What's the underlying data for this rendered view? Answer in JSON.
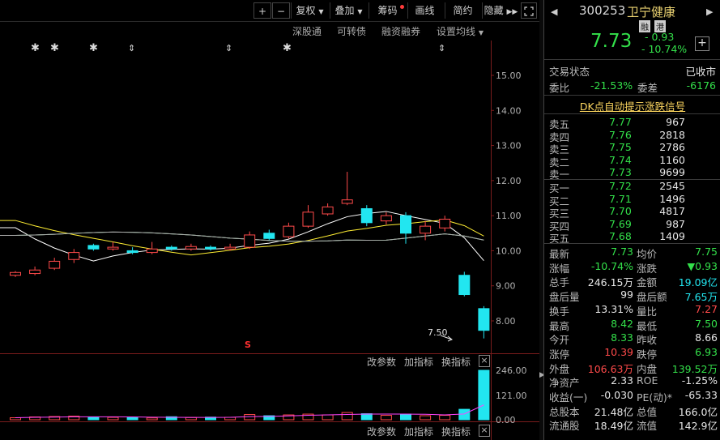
{
  "toolbar": {
    "plus": "+",
    "minus": "−",
    "fuquan": "复权",
    "diejia": "叠加",
    "chouma": "筹码",
    "huaxian": "画线",
    "jianyue": "简约",
    "yincang": "隐藏"
  },
  "subbar": {
    "shengutong": "深股通",
    "kezhuanzhai": "可转债",
    "rongzirongquan": "融资融券",
    "set_ma": "设置均线"
  },
  "price_axis": [
    "15.00",
    "14.00",
    "13.00",
    "12.00",
    "11.00",
    "10.00",
    "9.00",
    "8.00"
  ],
  "vol_axis": [
    "246.00",
    "121.00",
    "0.00"
  ],
  "low_label": "7.50",
  "s_marker": "S",
  "indicator_bar": {
    "edit_params": "改参数",
    "add_indicator": "加指标",
    "switch_indicator": "换指标",
    "close": "×"
  },
  "chart_data": {
    "type": "candlestick",
    "candles": [
      {
        "o": 9.3,
        "c": 9.38,
        "h": 9.42,
        "l": 9.25,
        "v": 10
      },
      {
        "o": 9.35,
        "c": 9.45,
        "h": 9.55,
        "l": 9.3,
        "v": 14
      },
      {
        "o": 9.5,
        "c": 9.7,
        "h": 9.8,
        "l": 9.45,
        "v": 16
      },
      {
        "o": 9.75,
        "c": 9.95,
        "h": 10.05,
        "l": 9.65,
        "v": 18
      },
      {
        "o": 10.15,
        "c": 10.05,
        "h": 10.2,
        "l": 10.0,
        "v": 14
      },
      {
        "o": 10.05,
        "c": 10.1,
        "h": 10.25,
        "l": 10.0,
        "v": 12
      },
      {
        "o": 10.0,
        "c": 9.95,
        "h": 10.1,
        "l": 9.9,
        "v": 10
      },
      {
        "o": 9.95,
        "c": 10.05,
        "h": 10.25,
        "l": 9.9,
        "v": 9
      },
      {
        "o": 10.1,
        "c": 10.05,
        "h": 10.15,
        "l": 10.0,
        "v": 15
      },
      {
        "o": 10.05,
        "c": 10.12,
        "h": 10.2,
        "l": 10.0,
        "v": 11
      },
      {
        "o": 10.1,
        "c": 10.05,
        "h": 10.15,
        "l": 10.0,
        "v": 13
      },
      {
        "o": 10.05,
        "c": 10.1,
        "h": 10.2,
        "l": 10.0,
        "v": 12
      },
      {
        "o": 10.1,
        "c": 10.45,
        "h": 10.55,
        "l": 10.05,
        "v": 26
      },
      {
        "o": 10.5,
        "c": 10.35,
        "h": 10.6,
        "l": 10.3,
        "v": 20
      },
      {
        "o": 10.4,
        "c": 10.7,
        "h": 10.8,
        "l": 10.35,
        "v": 24
      },
      {
        "o": 10.7,
        "c": 11.1,
        "h": 11.3,
        "l": 10.65,
        "v": 28
      },
      {
        "o": 11.05,
        "c": 11.25,
        "h": 11.35,
        "l": 11.0,
        "v": 24
      },
      {
        "o": 11.35,
        "c": 11.45,
        "h": 12.25,
        "l": 11.3,
        "v": 36
      },
      {
        "o": 11.2,
        "c": 10.8,
        "h": 11.3,
        "l": 10.7,
        "v": 30
      },
      {
        "o": 10.85,
        "c": 11.0,
        "h": 11.1,
        "l": 10.75,
        "v": 22
      },
      {
        "o": 11.0,
        "c": 10.5,
        "h": 11.1,
        "l": 10.2,
        "v": 28
      },
      {
        "o": 10.5,
        "c": 10.7,
        "h": 10.85,
        "l": 10.3,
        "v": 20
      },
      {
        "o": 10.65,
        "c": 10.9,
        "h": 11.0,
        "l": 10.55,
        "v": 22
      },
      {
        "o": 9.3,
        "c": 8.75,
        "h": 9.4,
        "l": 8.7,
        "v": 52
      },
      {
        "o": 8.35,
        "c": 7.73,
        "h": 8.42,
        "l": 7.5,
        "v": 246
      }
    ]
  },
  "header": {
    "code": "300253",
    "name": "卫宁健康",
    "tag_rong": "融",
    "tag_gang": "港",
    "price": "7.73",
    "change": "- 0.93",
    "change_pct": "- 10.74%",
    "add": "+"
  },
  "status": {
    "label": "交易状态",
    "value": "已收市"
  },
  "weibi": {
    "label1": "委比",
    "value1": "-21.53%",
    "label2": "委差",
    "value2": "-6176"
  },
  "dk_signal": "DK点自动提示涨跌信号",
  "asks": [
    {
      "label": "卖五",
      "price": "7.77",
      "vol": "967"
    },
    {
      "label": "卖四",
      "price": "7.76",
      "vol": "2818"
    },
    {
      "label": "卖三",
      "price": "7.75",
      "vol": "2786"
    },
    {
      "label": "卖二",
      "price": "7.74",
      "vol": "1160"
    },
    {
      "label": "卖一",
      "price": "7.73",
      "vol": "9699"
    }
  ],
  "bids": [
    {
      "label": "买一",
      "price": "7.72",
      "vol": "2545"
    },
    {
      "label": "买二",
      "price": "7.71",
      "vol": "1496"
    },
    {
      "label": "买三",
      "price": "7.70",
      "vol": "4817"
    },
    {
      "label": "买四",
      "price": "7.69",
      "vol": "987"
    },
    {
      "label": "买五",
      "price": "7.68",
      "vol": "1409"
    }
  ],
  "stats": [
    {
      "l1": "最新",
      "v1": "7.73",
      "l2": "均价",
      "v2": "7.75"
    },
    {
      "l1": "涨幅",
      "v1": "-10.74%",
      "l2": "涨跌",
      "v2": "▼0.93"
    },
    {
      "l1": "总手",
      "v1": "246.15万",
      "l2": "金额",
      "v2": "19.09亿"
    },
    {
      "l1": "盘后量",
      "v1": "99",
      "l2": "盘后额",
      "v2": "7.65万"
    },
    {
      "l1": "换手",
      "v1": "13.31%",
      "l2": "量比",
      "v2": "7.27"
    },
    {
      "l1": "最高",
      "v1": "8.42",
      "l2": "最低",
      "v2": "7.50"
    },
    {
      "l1": "今开",
      "v1": "8.33",
      "l2": "昨收",
      "v2": "8.66"
    },
    {
      "l1": "涨停",
      "v1": "10.39",
      "l2": "跌停",
      "v2": "6.93"
    },
    {
      "l1": "外盘",
      "v1": "106.63万",
      "l2": "内盘",
      "v2": "139.52万"
    },
    {
      "l1": "净资产",
      "v1": "2.33",
      "l2": "ROE",
      "v2": "-1.25%"
    },
    {
      "l1": "收益(一)",
      "v1": "-0.030",
      "l2": "PE(动)*",
      "v2": "-65.33"
    },
    {
      "l1": "总股本",
      "v1": "21.48亿",
      "l2": "总值",
      "v2": "166.0亿"
    },
    {
      "l1": "流通股",
      "v1": "18.49亿",
      "l2": "流值",
      "v2": "142.9亿"
    }
  ],
  "colors": {
    "up": "#ff4a4a",
    "down": "#22e6f0",
    "green": "#33e04a"
  }
}
